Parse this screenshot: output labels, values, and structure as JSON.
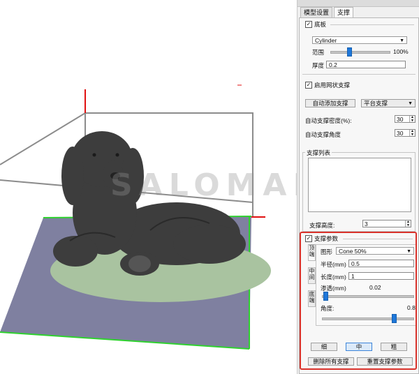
{
  "watermark": "SALOMAN",
  "tabs": [
    {
      "label": "模型设置",
      "active": false
    },
    {
      "label": "支撑",
      "active": true
    }
  ],
  "base": {
    "label": "底板",
    "checked": true,
    "shape": "Cylinder",
    "range_label": "范围",
    "range_value": "100%",
    "range_level": 0.42,
    "thickness_label": "厚度",
    "thickness_value": "0.2"
  },
  "grid_support": {
    "label": "启用网状支撑",
    "checked": true
  },
  "auto_add_button": "自动添加支撑",
  "platform_support": "平台支撑",
  "auto_density": {
    "label": "自动支撑密度(%):",
    "value": "30"
  },
  "auto_angle": {
    "label": "自动支撑角度",
    "value": "30"
  },
  "support_list": {
    "label": "支撑列表"
  },
  "support_height": {
    "label": "支撑高度:",
    "value": "3"
  },
  "support_params": {
    "label": "支撑参数",
    "checked": true,
    "side_tabs": [
      "顶端",
      "中间",
      "底端"
    ],
    "shape_label": "图形",
    "shape_value": "Cone 50%",
    "radius_label": "半径(mm)",
    "radius_value": "0.5",
    "length_label": "长度(mm)",
    "length_value": "1",
    "penetration_label": "渗透(mm)",
    "penetration_value": "0.02",
    "penetration_level": 0.02,
    "angle_label": "角度:",
    "angle_value": "0.8",
    "angle_level": 0.8
  },
  "size_buttons": {
    "thin": "细",
    "medium": "中",
    "thick": "粗"
  },
  "delete_all_button": "删除所有支撑",
  "reset_button": "重置支撑参数",
  "colors": {
    "accent": "#1f77d9",
    "highlight_frame": "#d9322b",
    "platform": "#7f80a0",
    "base_disc": "#a9c3a0",
    "model": "#3d3d3d"
  }
}
